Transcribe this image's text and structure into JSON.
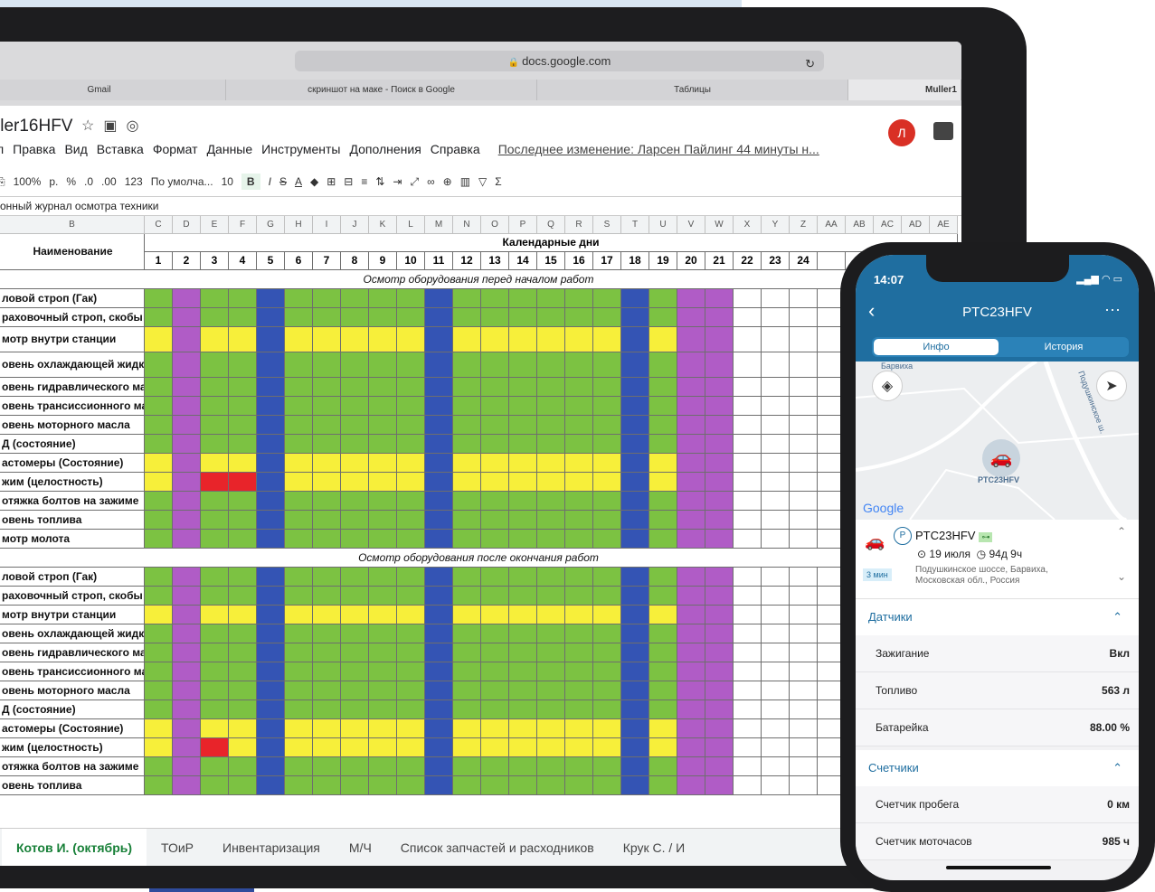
{
  "browser": {
    "url": "docs.google.com",
    "tabs": [
      "Gmail",
      "скриншот на маке - Поиск в Google",
      "Таблицы",
      "Muller1"
    ]
  },
  "doc": {
    "title": "ller16HFV",
    "menu": [
      "л",
      "Правка",
      "Вид",
      "Вставка",
      "Формат",
      "Данные",
      "Инструменты",
      "Дополнения",
      "Справка"
    ],
    "last_edit": "Последнее изменение: Ларсен Пайлинг 44 минуты н...",
    "avatar": "Л",
    "toolbar": [
      "100%",
      "р.",
      "%",
      ".0",
      ".00",
      "123",
      "По умолча...",
      "10",
      "B",
      "I",
      "S",
      "A"
    ],
    "formula_text": "онный журнал осмотра техники"
  },
  "sheet": {
    "col_letters": [
      "B",
      "C",
      "D",
      "E",
      "F",
      "G",
      "H",
      "I",
      "J",
      "K",
      "L",
      "M",
      "N",
      "O",
      "P",
      "Q",
      "R",
      "S",
      "T",
      "U",
      "V",
      "W",
      "X",
      "Y",
      "Z",
      "AA",
      "AB",
      "AC",
      "AD",
      "AE"
    ],
    "name_header": "Наименование",
    "days_header": "Календарные дни",
    "day_numbers": [
      "1",
      "2",
      "3",
      "4",
      "5",
      "6",
      "7",
      "8",
      "9",
      "10",
      "11",
      "12",
      "13",
      "14",
      "15",
      "16",
      "17",
      "18",
      "19",
      "20",
      "21",
      "22",
      "23",
      "24"
    ],
    "section1": "Осмотр оборудования перед началом работ",
    "section2": "Осмотр оборудования после окончания работ",
    "rows1": [
      "ловой строп (Гак)",
      "раховочный строп, скобы",
      "мотр внутри станции",
      "овень охлаждающей жидкости",
      "овень гидравлического масла",
      "овень трансиссионного масла",
      "овень моторного масла",
      "Д (состояние)",
      "астомеры (Состояние)",
      "жим (целостность)",
      "отяжка болтов на зажиме",
      "овень топлива",
      "мотр молота"
    ],
    "rows2": [
      "ловой строп (Гак)",
      "раховочный строп, скобы",
      "мотр внутри станции",
      "овень охлаждающей жидкости",
      "овень гидравлического масла",
      "овень трансиссионного масла",
      "овень моторного масла",
      "Д (состояние)",
      "астомеры (Состояние)",
      "жим (целостность)",
      "отяжка болтов на зажиме",
      "овень топлива"
    ],
    "colors": {
      "green": "#7cc242",
      "yellow": "#f7ef3a",
      "blue": "#3454b4",
      "purple": "#b05cc6",
      "red": "#e8242a",
      "white": "#ffffff"
    },
    "sheet_tabs": [
      "Котов И. (октябрь)",
      "ТОиР",
      "Инвентаризация",
      "М/Ч",
      "Список запчастей и расходников",
      "Крук С. / И"
    ]
  },
  "phone": {
    "time": "14:07",
    "title": "PTC23HFV",
    "segments": [
      "Инфо",
      "История"
    ],
    "map_labels": [
      "Барвиха",
      "Подушкинское ш.",
      "PTC23HFV"
    ],
    "google": "Google",
    "vehicle": {
      "name": "PTC23HFV",
      "date": "19 июля",
      "duration": "94д 9ч",
      "address": "Подушкинское шоссе, Барвиха, Московская обл., Россия",
      "ago": "3 мин",
      "badge": "P"
    },
    "sensors": {
      "title": "Датчики",
      "items": [
        {
          "label": "Зажигание",
          "value": "Вкл"
        },
        {
          "label": "Топливо",
          "value": "563 л"
        },
        {
          "label": "Батарейка",
          "value": "88.00 %"
        }
      ]
    },
    "counters": {
      "title": "Счетчики",
      "items": [
        {
          "label": "Счетчик пробега",
          "value": "0 км"
        },
        {
          "label": "Счетчик моточасов",
          "value": "985 ч"
        }
      ]
    }
  }
}
